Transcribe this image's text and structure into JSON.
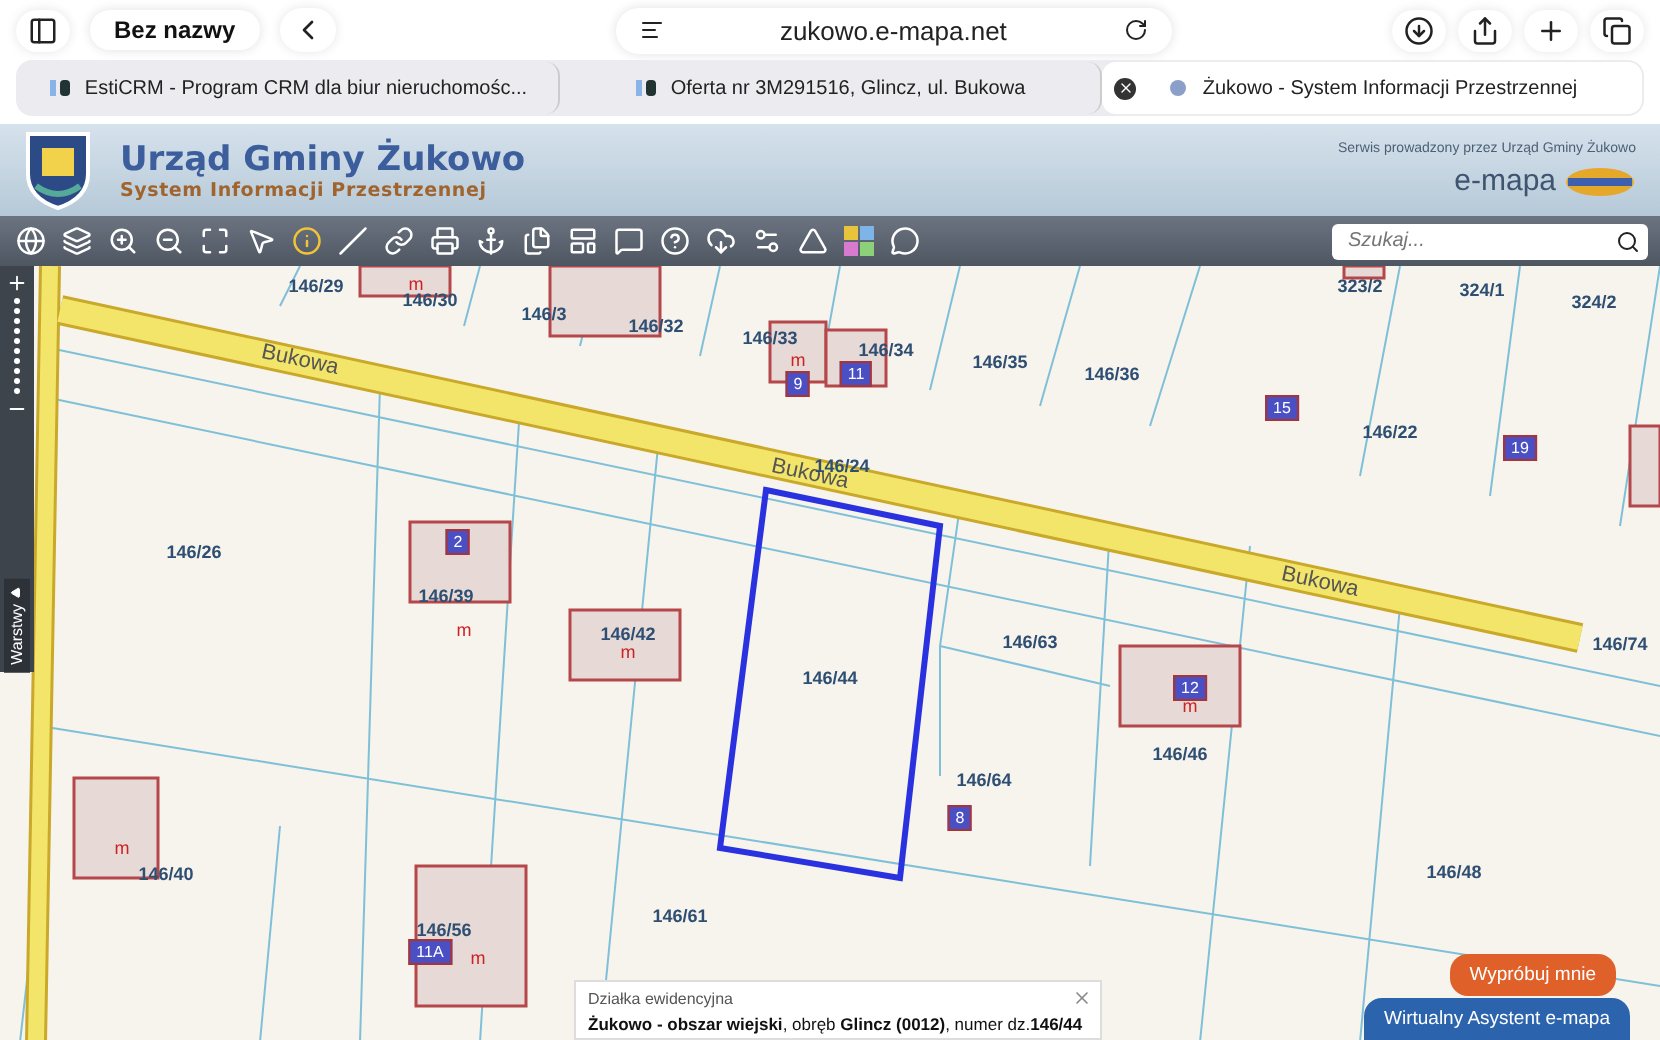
{
  "browser": {
    "tab_group": "Bez nazwy",
    "url": "zukowo.e-mapa.net",
    "tabs": [
      {
        "title": "EstiCRM - Program CRM dla biur nieruchomośc...",
        "selected": false
      },
      {
        "title": "Oferta nr 3M291516, Glincz, ul. Bukowa",
        "selected": false
      },
      {
        "title": "Żukowo - System Informacji Przestrzennej",
        "selected": true
      }
    ]
  },
  "header": {
    "title": "Urząd Gminy Żukowo",
    "subtitle": "System Informacji Przestrzennej",
    "operator_note": "Serwis prowadzony przez Urząd Gminy Żukowo",
    "brand": "e-mapa"
  },
  "search": {
    "placeholder": "Szukaj..."
  },
  "map": {
    "streets": [
      "Bukowa",
      "Bukowa",
      "Bukowa"
    ],
    "parcels": [
      "146/29",
      "146/30",
      "146/3",
      "146/32",
      "146/33",
      "146/34",
      "146/35",
      "146/36",
      "323/2",
      "324/1",
      "324/2",
      "146/22",
      "146/24",
      "146/26",
      "146/39",
      "146/42",
      "146/63",
      "146/74",
      "146/44",
      "146/46",
      "146/64",
      "146/40",
      "146/48",
      "146/56",
      "146/61"
    ],
    "house_numbers": [
      "9",
      "11",
      "15",
      "19",
      "2",
      "8",
      "12",
      "11A"
    ],
    "building_marks": [
      "m",
      "m",
      "m",
      "m",
      "m",
      "m",
      "m"
    ],
    "layers_tab": "Warstwy"
  },
  "popup": {
    "title": "Działka ewidencyjna",
    "text": "**Żukowo - obszar wiejski**, obręb **Glincz (0012)**, numer dz.**146/44**"
  },
  "buttons": [
    {
      "label": "Wypróbuj mnie",
      "kind": "try"
    },
    {
      "label": "Wirtualny Asystent e-mapa",
      "kind": "assistant"
    }
  ]
}
